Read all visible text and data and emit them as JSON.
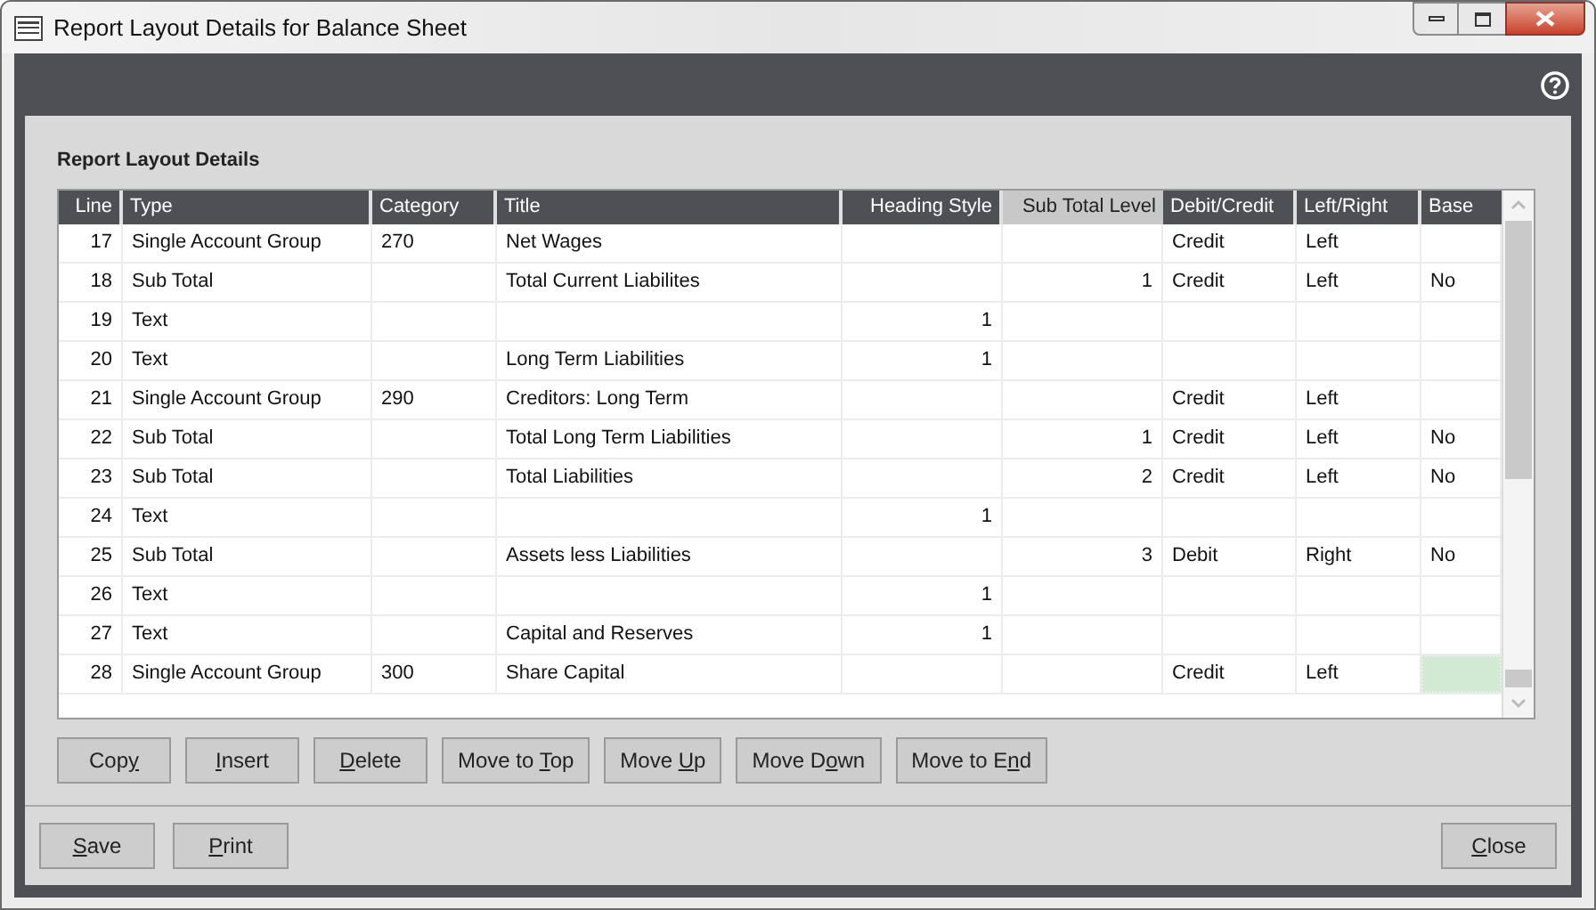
{
  "window": {
    "title": "Report Layout Details for Balance Sheet"
  },
  "section_title": "Report Layout Details",
  "table": {
    "columns": [
      {
        "label": "Line",
        "selected": false
      },
      {
        "label": "Type",
        "selected": false
      },
      {
        "label": "Category",
        "selected": false
      },
      {
        "label": "Title",
        "selected": false
      },
      {
        "label": "Heading Style",
        "selected": false
      },
      {
        "label": "Sub Total Level",
        "selected": true
      },
      {
        "label": "Debit/Credit",
        "selected": false
      },
      {
        "label": "Left/Right",
        "selected": false
      },
      {
        "label": "Base",
        "selected": false
      }
    ],
    "rows": [
      {
        "cells": [
          "17",
          "Single Account Group",
          "270",
          "Net Wages",
          "",
          "",
          "Credit",
          "Left",
          ""
        ],
        "selected": false
      },
      {
        "cells": [
          "18",
          "Sub Total",
          "",
          "Total Current Liabilites",
          "",
          "1",
          "Credit",
          "Left",
          "No"
        ],
        "selected": false
      },
      {
        "cells": [
          "19",
          "Text",
          "",
          "",
          "1",
          "",
          "",
          "",
          ""
        ],
        "selected": false
      },
      {
        "cells": [
          "20",
          "Text",
          "",
          "Long Term Liabilities",
          "1",
          "",
          "",
          "",
          ""
        ],
        "selected": false
      },
      {
        "cells": [
          "21",
          "Single Account Group",
          "290",
          "Creditors: Long Term",
          "",
          "",
          "Credit",
          "Left",
          ""
        ],
        "selected": false
      },
      {
        "cells": [
          "22",
          "Sub Total",
          "",
          "Total Long Term Liabilities",
          "",
          "1",
          "Credit",
          "Left",
          "No"
        ],
        "selected": false
      },
      {
        "cells": [
          "23",
          "Sub Total",
          "",
          "Total Liabilities",
          "",
          "2",
          "Credit",
          "Left",
          "No"
        ],
        "selected": false
      },
      {
        "cells": [
          "24",
          "Text",
          "",
          "",
          "1",
          "",
          "",
          "",
          ""
        ],
        "selected": false
      },
      {
        "cells": [
          "25",
          "Sub Total",
          "",
          "Assets less Liabilities",
          "",
          "3",
          "Debit",
          "Right",
          "No"
        ],
        "selected": false
      },
      {
        "cells": [
          "26",
          "Text",
          "",
          "",
          "1",
          "",
          "",
          "",
          ""
        ],
        "selected": false
      },
      {
        "cells": [
          "27",
          "Text",
          "",
          "Capital and Reserves",
          "1",
          "",
          "",
          "",
          ""
        ],
        "selected": false
      },
      {
        "cells": [
          "28",
          "Single Account Group",
          "300",
          "Share Capital",
          "",
          "",
          "Credit",
          "Left",
          ""
        ],
        "selected": true
      }
    ]
  },
  "row_buttons": [
    {
      "before": "Cop",
      "key": "y"
    },
    {
      "key": "I",
      "after": "nsert"
    },
    {
      "key": "D",
      "after": "elete"
    },
    {
      "before": "Move to ",
      "key": "T",
      "after": "op"
    },
    {
      "before": "Move ",
      "key": "U",
      "after": "p"
    },
    {
      "before": "Move D",
      "key": "o",
      "after": "wn"
    },
    {
      "before": "Move to E",
      "key": "n",
      "after": "d"
    }
  ],
  "footer_left_buttons": [
    {
      "key": "S",
      "after": "ave"
    },
    {
      "key": "P",
      "after": "rint"
    }
  ],
  "footer_right_buttons": [
    {
      "key": "C",
      "after": "lose"
    }
  ]
}
